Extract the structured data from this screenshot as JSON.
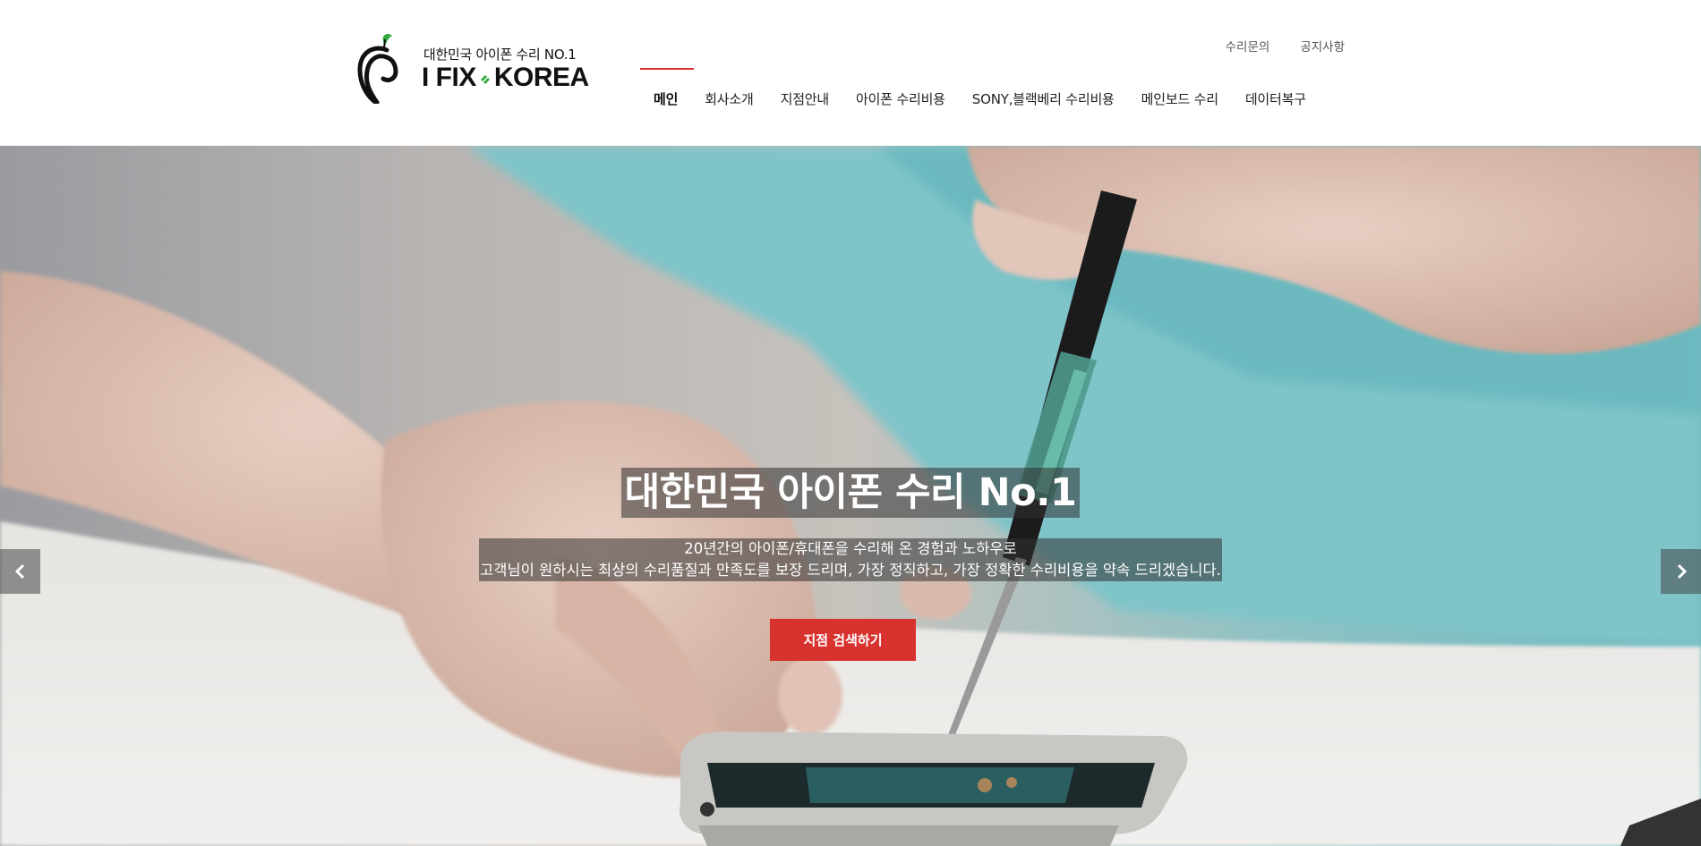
{
  "logo": {
    "tagline": "대한민국 아이폰 수리 NO.1",
    "word_left": "I FIX",
    "word_right": "KOREA",
    "icon": "apple-leaf-icon",
    "leaf_color": "#2eaa3c"
  },
  "util_nav": [
    {
      "label": "수리문의"
    },
    {
      "label": "공지사항"
    }
  ],
  "main_nav": [
    {
      "label": "메인",
      "active": true
    },
    {
      "label": "회사소개"
    },
    {
      "label": "지점안내"
    },
    {
      "label": "아이폰 수리비용"
    },
    {
      "label": "SONY,블랙베리 수리비용"
    },
    {
      "label": "메인보드 수리"
    },
    {
      "label": "데이터복구"
    }
  ],
  "hero": {
    "title": "대한민국 아이폰 수리 No.1",
    "subtitle_line1": "20년간의 아이폰/휴대폰을 수리해 온 경험과 노하우로",
    "subtitle_line2": "고객님이 원하시는 최상의 수리품질과 만족도를 보장 드리며, 가장 정직하고, 가장 정확한 수리비용을 약속 드리겠습니다.",
    "button_label": "지점 검색하기",
    "prev_icon": "chevron-left-icon",
    "next_icon": "chevron-right-icon"
  },
  "colors": {
    "accent": "#d8322f",
    "overlay": "#323232"
  }
}
